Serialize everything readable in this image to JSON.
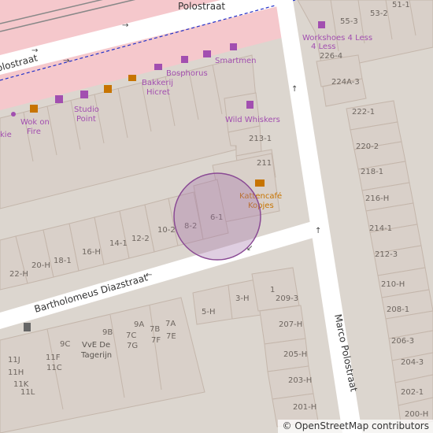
{
  "map": {
    "streets": {
      "polostraat_top": "Polostraat",
      "polostraat_left": "Polostraat",
      "bartholomeus": "Bartholomeus Diazstraat",
      "marco": "Marco Polostraat"
    },
    "pois": {
      "workshoes": "Workshoes 4 Less",
      "smartmen": "Smartmen",
      "bosphorus": "Bosphorus",
      "bakkerij": "Bakkerij Hicret",
      "studio": "Studio Point",
      "wok": "Wok on Fire",
      "kie": "kie",
      "wild": "Wild Whiskers",
      "katten": "Kattencafé Kopjes"
    },
    "house_numbers": {
      "n51_1": "51-1",
      "n53_2": "53-2",
      "n55_3": "55-3",
      "n226_4": "226-4",
      "n224a_3": "224A-3",
      "n222_1": "222-1",
      "n220_2": "220-2",
      "n218_1": "218-1",
      "n216_h": "216-H",
      "n214_1": "214-1",
      "n212_3": "212-3",
      "n210_h": "210-H",
      "n208_1": "208-1",
      "n206_3": "206-3",
      "n204_3": "204-3",
      "n202_1": "202-1",
      "n200_h": "200-H",
      "n213_1": "213-1",
      "n211": "211",
      "n6_1": "6-1",
      "n8_2": "8-2",
      "n10_2": "10-2",
      "n12_2": "12-2",
      "n14_1": "14-1",
      "n16_h": "16-H",
      "n18_1": "18-1",
      "n20_h": "20-H",
      "n22_h": "22-H",
      "n1": "1",
      "n209_3": "209-3",
      "n3_h": "3-H",
      "n5_h": "5-H",
      "n207_h": "207-H",
      "n205_h": "205-H",
      "n203_h": "203-H",
      "n201_h": "201-H",
      "n9b": "9B",
      "n9a": "9A",
      "n7b": "7B",
      "n7a": "7A",
      "n7c": "7C",
      "n7f": "7F",
      "n7e": "7E",
      "n7g": "7G",
      "n9c": "9C",
      "n11f": "11F",
      "n11c": "11C",
      "n11h": "11H",
      "n11j": "11J",
      "n11k": "11K",
      "n11l": "11L"
    },
    "building_name": "VvE De Tagerijn",
    "attribution": "© OpenStreetMap contributors",
    "colors": {
      "background": "#dcd6cf",
      "building": "#d9d0c9",
      "building_stroke": "#c4b6ab",
      "pedestrian": "#f5c8cc",
      "road": "#ffffff",
      "poi_purple": "#a24fb0",
      "poi_orange": "#c77400",
      "marker": "#a272a8"
    },
    "icons": [
      "shirt-icon",
      "clothes-icon",
      "hairdresser-icon",
      "bakery-icon",
      "fastfood-icon",
      "restaurant-icon",
      "beauty-icon",
      "flower-icon",
      "takeaway-icon",
      "cafe-icon",
      "pet-icon",
      "waste-basket-icon"
    ]
  }
}
